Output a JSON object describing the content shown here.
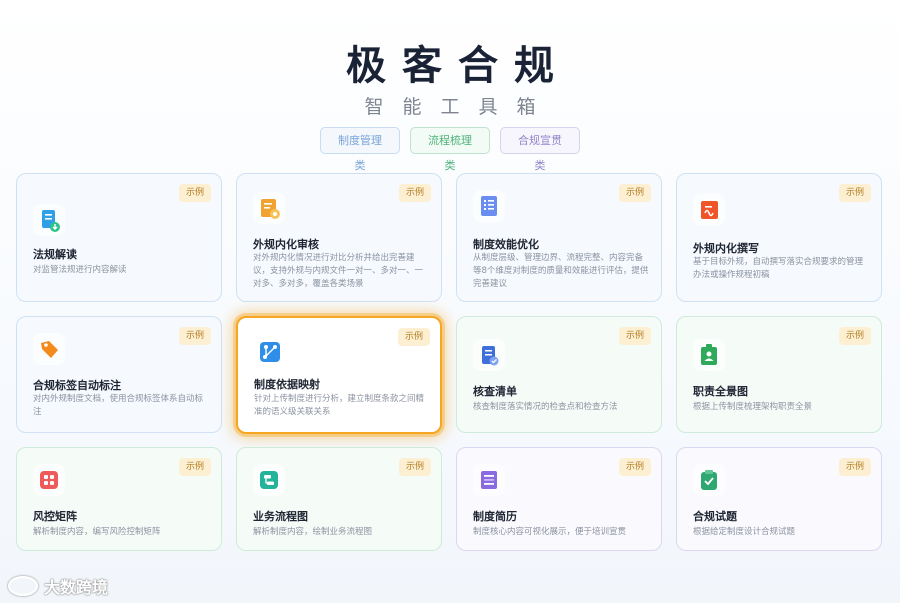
{
  "header": {
    "title": "极客合规",
    "subtitle": "智能工具箱"
  },
  "tabs": [
    {
      "label": "制度管理类",
      "color": "#7aa3d6"
    },
    {
      "label": "流程梳理类",
      "color": "#4fb27a"
    },
    {
      "label": "合规宣贯类",
      "color": "#9185c9"
    }
  ],
  "tag_label": "示例",
  "cards": [
    {
      "name": "法规解读",
      "desc": "对监管法规进行内容解读",
      "icon": "document-download-icon",
      "icon_color": "#2f9fe8"
    },
    {
      "name": "外规内化审核",
      "desc": "对外规内化情况进行对比分析并给出完善建议，支持外规与内规文件一对一、多对一、一对多、多对多，覆盖各类场景",
      "icon": "review-icon",
      "icon_color": "#f0a330"
    },
    {
      "name": "制度效能优化",
      "desc": "从制度层级、管理边界、流程完整、内容完备等8个维度对制度的质量和效能进行评估，提供完善建议",
      "icon": "checklist-icon",
      "icon_color": "#4e7de0"
    },
    {
      "name": "外规内化撰写",
      "desc": "基于目标外规，自动撰写落实合规要求的管理办法或操作规程初稿",
      "icon": "write-icon",
      "icon_color": "#f0552a"
    },
    {
      "name": "合规标签自动标注",
      "desc": "对内外规制度文档，使用合规标签体系自动标注",
      "icon": "tag-icon",
      "icon_color": "#f58a1c"
    },
    {
      "name": "制度依据映射",
      "desc": "针对上传制度进行分析，建立制度条款之间精准的语义级关联关系",
      "icon": "mapping-icon",
      "icon_color": "#2f8fe8"
    },
    {
      "name": "核查清单",
      "desc": "核查制度落实情况的检查点和检查方法",
      "icon": "clipboard-icon",
      "icon_color": "#3f6fd8"
    },
    {
      "name": "职责全景图",
      "desc": "根据上传制度梳理架构职责全景",
      "icon": "id-card-icon",
      "icon_color": "#2eaa5a"
    },
    {
      "name": "风控矩阵",
      "desc": "解析制度内容，编写风险控制矩阵",
      "icon": "grid-icon",
      "icon_color": "#ef5b5b"
    },
    {
      "name": "业务流程图",
      "desc": "解析制度内容，绘制业务流程图",
      "icon": "flowchart-icon",
      "icon_color": "#22b39a"
    },
    {
      "name": "制度简历",
      "desc": "制度核心内容可视化展示，便于培训宣贯",
      "icon": "resume-icon",
      "icon_color": "#8a6ae0"
    },
    {
      "name": "合规试题",
      "desc": "根据给定制度设计合规试题",
      "icon": "exam-icon",
      "icon_color": "#2ea870"
    }
  ],
  "watermark": "大数跨境"
}
